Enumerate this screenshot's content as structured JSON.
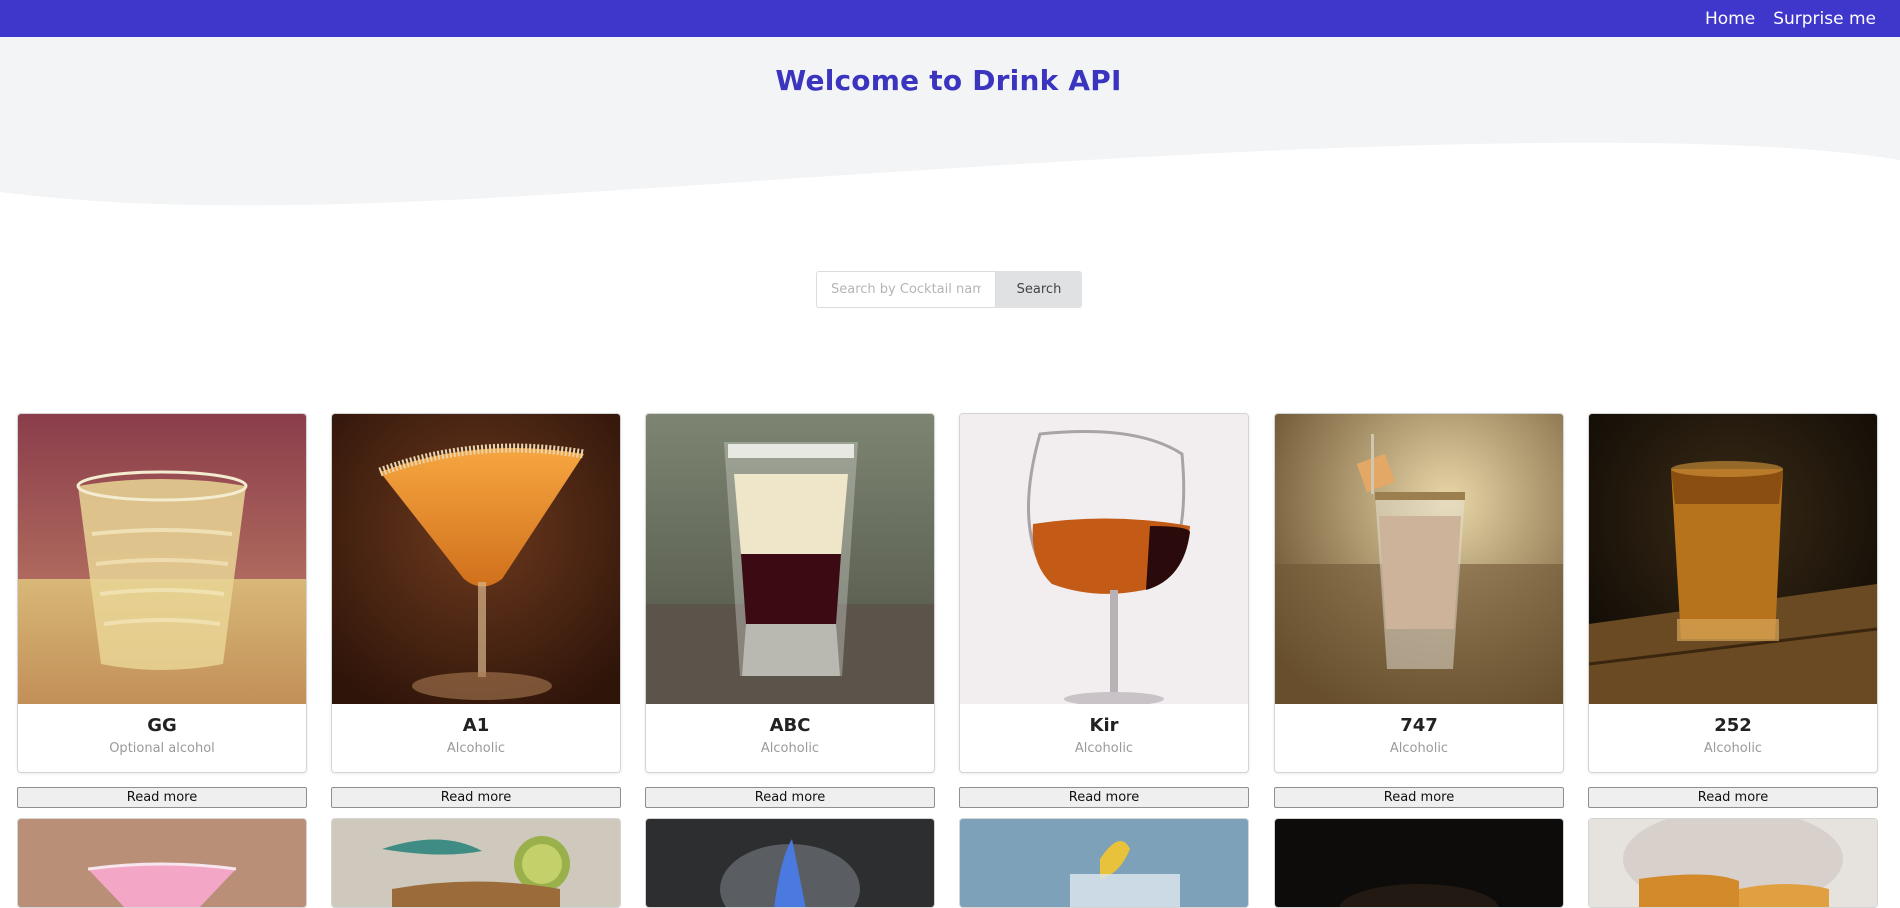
{
  "nav": {
    "links": [
      {
        "label": "Home"
      },
      {
        "label": "Surprise me"
      }
    ]
  },
  "hero": {
    "title": "Welcome to Drink API"
  },
  "search": {
    "placeholder": "Search by Cocktail name...",
    "button_label": "Search"
  },
  "drinks": [
    {
      "name": "GG",
      "category": "Optional alcohol",
      "read_more": "Read more"
    },
    {
      "name": "A1",
      "category": "Alcoholic",
      "read_more": "Read more"
    },
    {
      "name": "ABC",
      "category": "Alcoholic",
      "read_more": "Read more"
    },
    {
      "name": "Kir",
      "category": "Alcoholic",
      "read_more": "Read more"
    },
    {
      "name": "747",
      "category": "Alcoholic",
      "read_more": "Read more"
    },
    {
      "name": "252",
      "category": "Alcoholic",
      "read_more": "Read more"
    }
  ],
  "colors": {
    "nav": "#3f36cb",
    "title": "#3a34bf",
    "hero_bg": "#f3f4f6"
  }
}
